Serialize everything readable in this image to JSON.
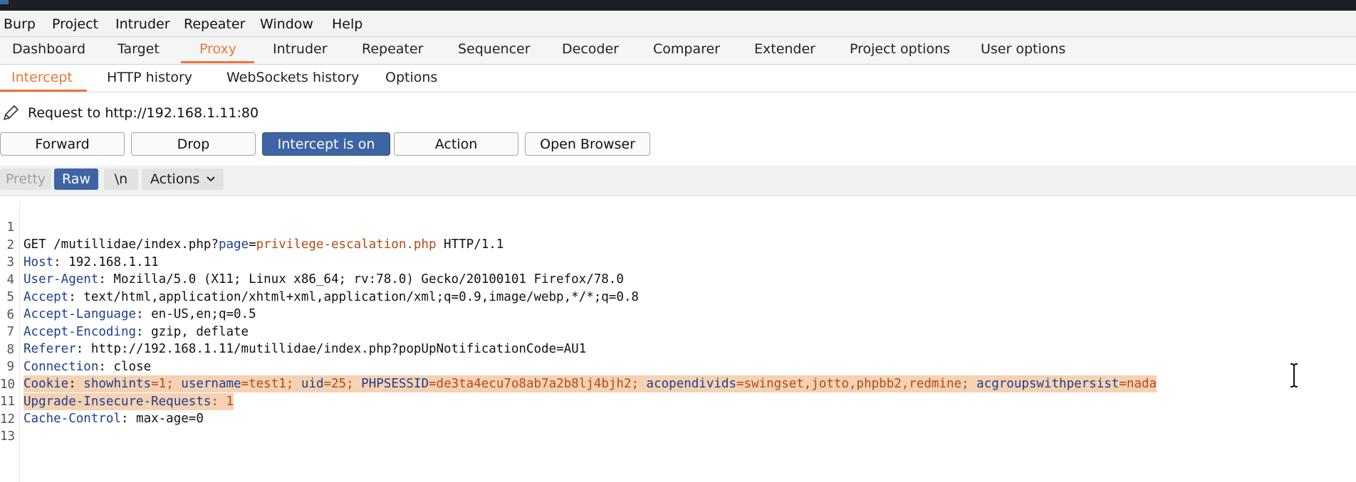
{
  "menubar": {
    "items": [
      "Burp",
      "Project",
      "Intruder",
      "Repeater",
      "Window",
      "Help"
    ]
  },
  "tabs": {
    "items": [
      "Dashboard",
      "Target",
      "Proxy",
      "Intruder",
      "Repeater",
      "Sequencer",
      "Decoder",
      "Comparer",
      "Extender",
      "Project options",
      "User options"
    ],
    "active": "Proxy"
  },
  "subtabs": {
    "items": [
      "Intercept",
      "HTTP history",
      "WebSockets history",
      "Options"
    ],
    "active": "Intercept"
  },
  "request": {
    "label": "Request to http://192.168.1.11:80"
  },
  "buttons": {
    "forward": "Forward",
    "drop": "Drop",
    "intercept": "Intercept is on",
    "action": "Action",
    "open_browser": "Open Browser"
  },
  "editor_tools": {
    "pretty": "Pretty",
    "raw": "Raw",
    "newline": "\\n",
    "actions": "Actions"
  },
  "editor": {
    "line_numbers": [
      "1",
      "2",
      "3",
      "4",
      "5",
      "6",
      "7",
      "8",
      "9",
      "10",
      "11",
      "12",
      "13"
    ],
    "l1": {
      "method": "GET /mutillidae/index.php?",
      "param": "page",
      "eq": "=",
      "value": "privilege-escalation.php",
      "proto": " HTTP/1.1"
    },
    "l2": {
      "key": "Host",
      "value": ": 192.168.1.11"
    },
    "l3": {
      "key": "User-Agent",
      "value": ": Mozilla/5.0 (X11; Linux x86_64; rv:78.0) Gecko/20100101 Firefox/78.0"
    },
    "l4": {
      "key": "Accept",
      "value": ": text/html,application/xhtml+xml,application/xml;q=0.9,image/webp,*/*;q=0.8"
    },
    "l5": {
      "key": "Accept-Language",
      "value": ": en-US,en;q=0.5"
    },
    "l6": {
      "key": "Accept-Encoding",
      "value": ": gzip, deflate"
    },
    "l7": {
      "key": "Referer",
      "value": ": http://192.168.1.11/mutillidae/index.php?popUpNotificationCode=AU1"
    },
    "l8": {
      "key": "Connection",
      "value": ": close"
    },
    "l9": {
      "key": "Cookie",
      "sep": ": ",
      "c1k": "showhints",
      "c1v": "=1; ",
      "c2k": "username",
      "c2v": "=test1; ",
      "c3k": "uid",
      "c3v": "=25; ",
      "c4k": "PHPSESSID",
      "c4v": "=de3ta4ecu7o8ab7a2b8lj4bjh2; ",
      "c5k": "acopendivids",
      "c5v": "=swingset,jotto,phpbb2,redmine; ",
      "c6k": "acgroupswithpersist",
      "c6v": "=nada"
    },
    "l10": {
      "key": "Upgrade-Insecure-Requests",
      "value": ": 1"
    },
    "l11": {
      "key": "Cache-Control",
      "value": ": max-age=0"
    }
  }
}
